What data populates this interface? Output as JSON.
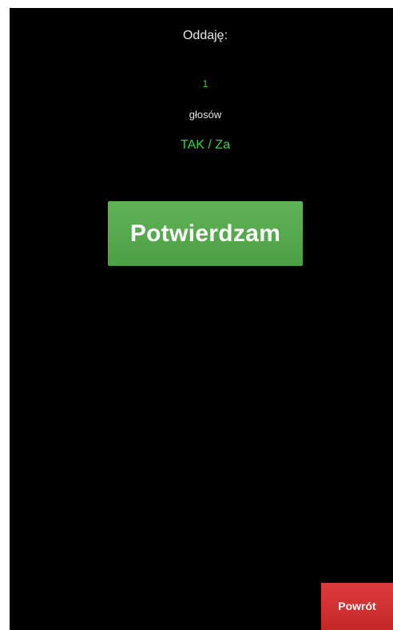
{
  "vote": {
    "title": "Oddaję:",
    "count": "1",
    "unit": "głosów",
    "choice": "TAK / Za"
  },
  "buttons": {
    "confirm_label": "Potwierdzam",
    "back_label": "Powrót"
  },
  "colors": {
    "background": "#000000",
    "highlight_text": "#22e022",
    "confirm_button": "#56a94c",
    "back_button": "#d13232"
  }
}
